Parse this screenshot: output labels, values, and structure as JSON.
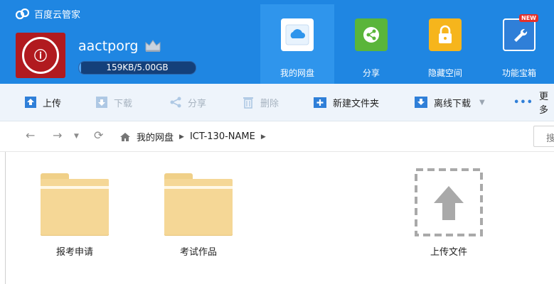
{
  "app": {
    "title": "百度云管家"
  },
  "account": {
    "username": "aactporg",
    "quota_text": "159KB/5.00GB",
    "quota_used_fraction": 3e-05
  },
  "nav": {
    "tabs": [
      {
        "label": "我的网盘",
        "active": true
      },
      {
        "label": "分享"
      },
      {
        "label": "隐藏空间"
      },
      {
        "label": "功能宝箱",
        "badge": "NEW"
      }
    ]
  },
  "toolbar": {
    "upload": "上传",
    "download": "下载",
    "share": "分享",
    "delete": "删除",
    "new_folder": "新建文件夹",
    "offline_download": "离线下载",
    "more": "更多"
  },
  "breadcrumb": {
    "items": [
      "我的网盘",
      "ICT-130-NAME"
    ]
  },
  "search": {
    "placeholder": "搜"
  },
  "files": [
    {
      "name": "报考申请",
      "type": "folder"
    },
    {
      "name": "考试作品",
      "type": "folder"
    }
  ],
  "upload_tile": {
    "label": "上传文件"
  },
  "colors": {
    "header": "#1f86e2",
    "active_tab": "#2f95ec",
    "toolbar": "#eef4fb",
    "folder": "#f5d796"
  }
}
